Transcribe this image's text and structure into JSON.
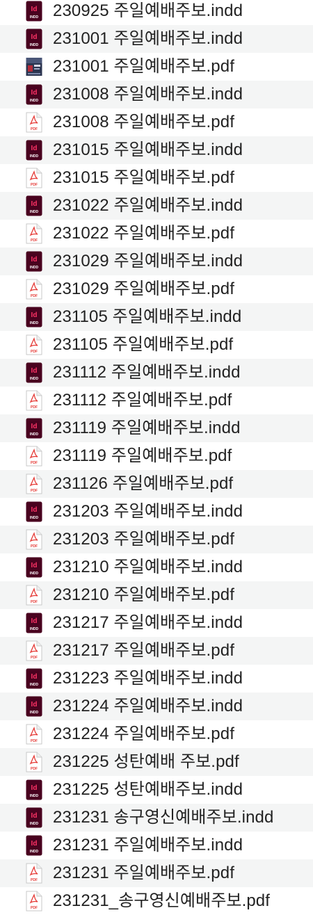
{
  "colors": {
    "row_alt_bg": "#f4f5f5",
    "text": "#222222",
    "indd_icon_bg": "#49021f",
    "indd_icon_accent": "#ff3366",
    "pdf_icon_red": "#e53935"
  },
  "files": [
    {
      "name": "230925 주일예배주보.indd",
      "icon": "indd-icon"
    },
    {
      "name": "231001 주일예배주보.indd",
      "icon": "indd-icon"
    },
    {
      "name": "231001 주일예배주보.pdf",
      "icon": "pdf-thumbnail-icon"
    },
    {
      "name": "231008 주일예배주보.indd",
      "icon": "indd-icon"
    },
    {
      "name": "231008 주일예배주보.pdf",
      "icon": "pdf-icon"
    },
    {
      "name": "231015 주일예배주보.indd",
      "icon": "indd-icon"
    },
    {
      "name": "231015 주일예배주보.pdf",
      "icon": "pdf-icon"
    },
    {
      "name": "231022 주일예배주보.indd",
      "icon": "indd-icon"
    },
    {
      "name": "231022 주일예배주보.pdf",
      "icon": "pdf-icon"
    },
    {
      "name": "231029 주일예배주보.indd",
      "icon": "indd-icon"
    },
    {
      "name": "231029 주일예배주보.pdf",
      "icon": "pdf-icon"
    },
    {
      "name": "231105 주일예배주보.indd",
      "icon": "indd-icon"
    },
    {
      "name": "231105 주일예배주보.pdf",
      "icon": "pdf-icon"
    },
    {
      "name": "231112 주일예배주보.indd",
      "icon": "indd-icon"
    },
    {
      "name": "231112 주일예배주보.pdf",
      "icon": "pdf-icon"
    },
    {
      "name": "231119 주일예배주보.indd",
      "icon": "indd-icon"
    },
    {
      "name": "231119 주일예배주보.pdf",
      "icon": "pdf-icon"
    },
    {
      "name": "231126 주일예배주보.pdf",
      "icon": "pdf-icon"
    },
    {
      "name": "231203 주일예배주보.indd",
      "icon": "indd-icon"
    },
    {
      "name": "231203 주일예배주보.pdf",
      "icon": "pdf-icon"
    },
    {
      "name": "231210 주일예배주보.indd",
      "icon": "indd-icon"
    },
    {
      "name": "231210 주일예배주보.pdf",
      "icon": "pdf-icon"
    },
    {
      "name": "231217 주일예배주보.indd",
      "icon": "indd-icon"
    },
    {
      "name": "231217 주일예배주보.pdf",
      "icon": "pdf-icon"
    },
    {
      "name": "231223 주일예배주보.indd",
      "icon": "indd-icon"
    },
    {
      "name": "231224 주일예배주보.indd",
      "icon": "indd-icon"
    },
    {
      "name": "231224 주일예배주보.pdf",
      "icon": "pdf-icon"
    },
    {
      "name": "231225 성탄예배 주보.pdf",
      "icon": "pdf-icon"
    },
    {
      "name": "231225 성탄예배주보.indd",
      "icon": "indd-icon"
    },
    {
      "name": "231231 송구영신예배주보.indd",
      "icon": "indd-icon"
    },
    {
      "name": "231231 주일예배주보.indd",
      "icon": "indd-icon"
    },
    {
      "name": "231231 주일예배주보.pdf",
      "icon": "pdf-icon"
    },
    {
      "name": "231231_송구영신예배주보.pdf",
      "icon": "pdf-icon"
    }
  ]
}
